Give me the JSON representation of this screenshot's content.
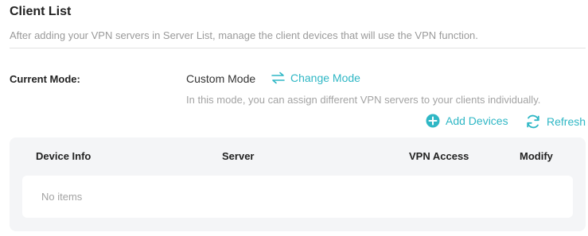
{
  "header": {
    "title": "Client List",
    "description": "After adding your VPN servers in Server List, manage the client devices that will use the VPN function."
  },
  "mode": {
    "label": "Current Mode:",
    "value": "Custom Mode",
    "change_label": "Change Mode",
    "hint": "In this mode, you can assign different VPN servers to your clients individually."
  },
  "actions": {
    "add_label": "Add Devices",
    "add_icon": "plus-circle-icon",
    "refresh_label": "Refresh",
    "refresh_icon": "refresh-icon",
    "change_icon": "swap-arrows-icon"
  },
  "table": {
    "columns": [
      "Device Info",
      "Server",
      "VPN Access",
      "Modify"
    ],
    "empty_text": "No items"
  },
  "colors": {
    "accent": "#2fb7c5",
    "panel_bg": "#f4f5f7",
    "muted_text": "#a3a3a3"
  }
}
